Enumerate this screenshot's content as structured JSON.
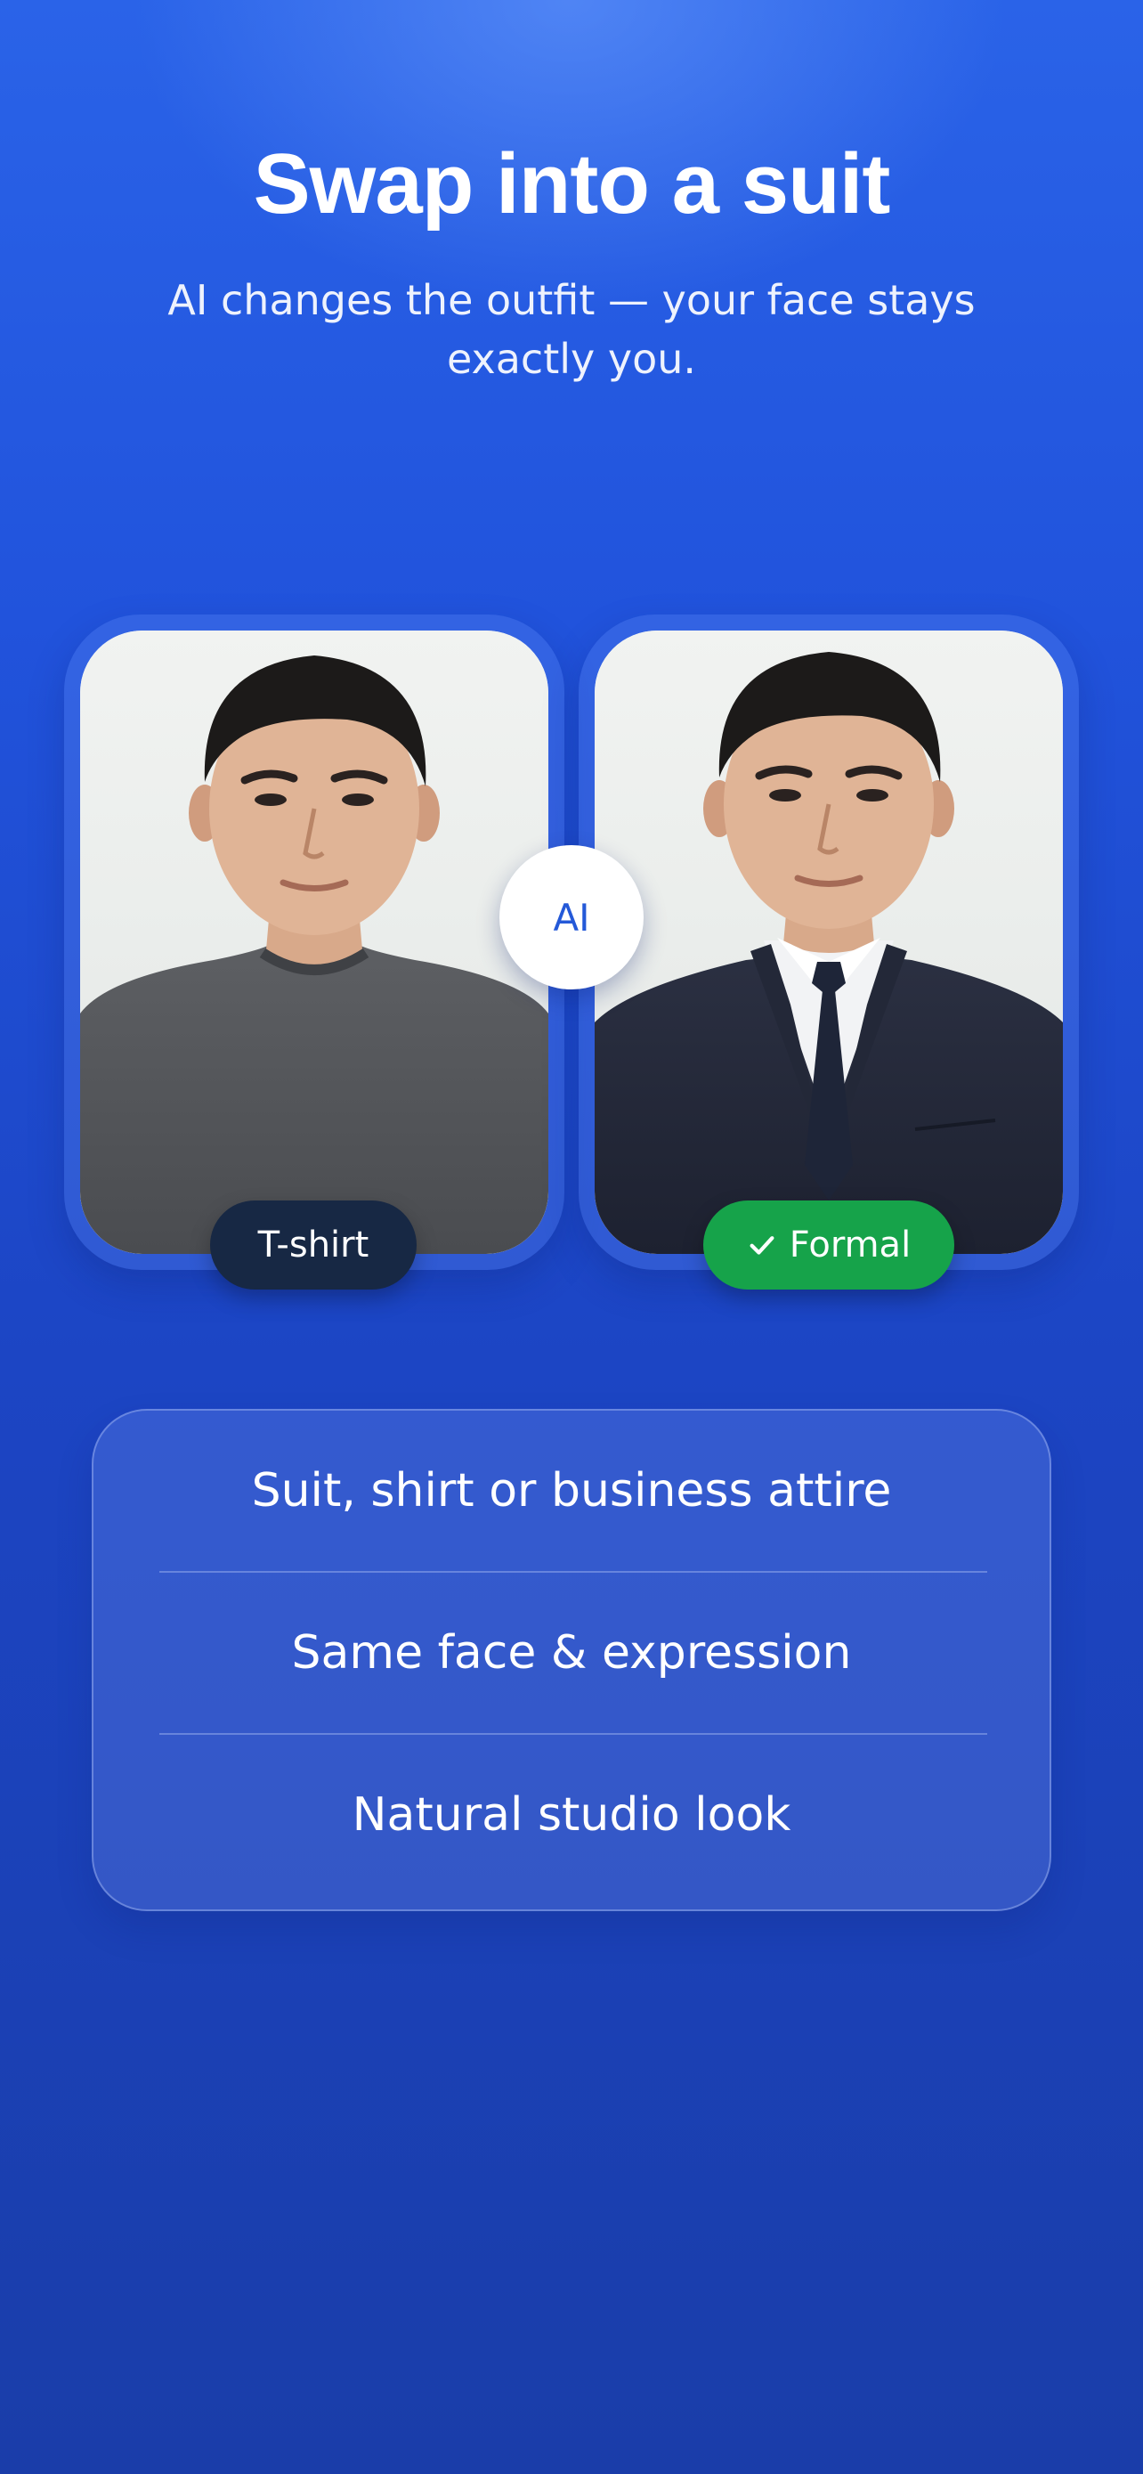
{
  "header": {
    "title": "Swap into a suit",
    "subtitle": "AI changes the outfit — your face stays exactly you."
  },
  "comparison": {
    "before": {
      "label": "T-shirt",
      "image_icon": "portrait-tshirt"
    },
    "after": {
      "label": "Formal",
      "check_icon": "checkmark-icon",
      "image_icon": "portrait-suit"
    },
    "center_badge": "AI"
  },
  "features": {
    "items": [
      "Suit, shirt or business attire",
      "Same face & expression",
      "Natural studio look"
    ]
  },
  "colors": {
    "background_top": "#2a63e8",
    "background_bottom": "#1a3da9",
    "tshirt_chip": "#172844",
    "formal_chip": "#16a34a",
    "badge_text": "#2459d8"
  }
}
